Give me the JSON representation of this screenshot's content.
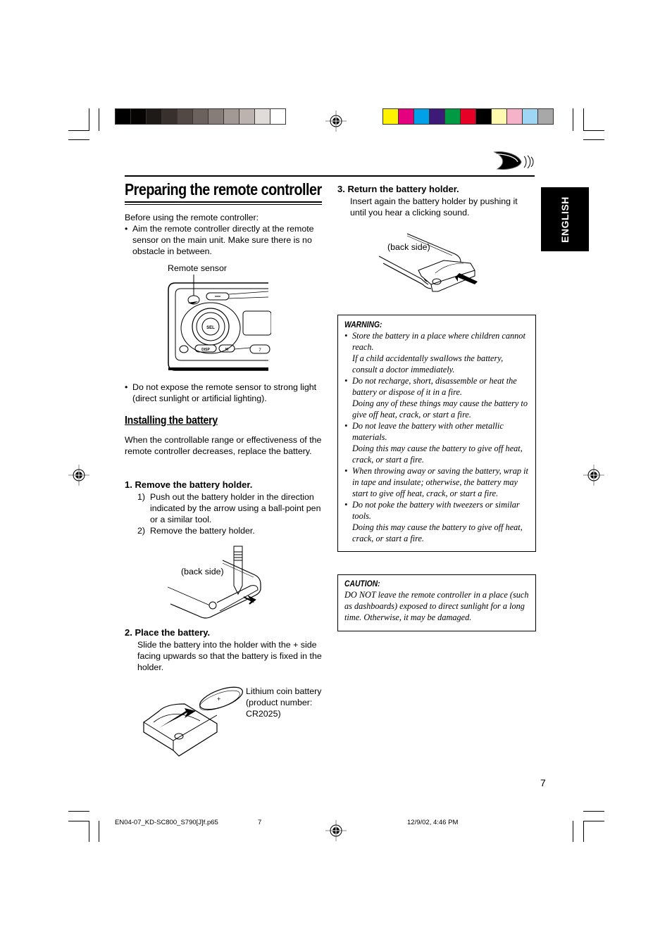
{
  "print_marks": {
    "grayscale_swatches": [
      "#000000",
      "#060403",
      "#1e1a17",
      "#38302c",
      "#524944",
      "#6b625e",
      "#877d78",
      "#a29894",
      "#bcb3af",
      "#e0dcd9",
      "#ffffff"
    ],
    "color_swatches": [
      "#fff200",
      "#e4007f",
      "#00a0e9",
      "#3e1a78",
      "#009944",
      "#e60026",
      "#000000",
      "#fff9b0",
      "#f5b2c9",
      "#9fd6f3",
      "#a8a8a8"
    ]
  },
  "header": {
    "language_tab": "ENGLISH",
    "logo_icon": "sound-wave-logo-icon"
  },
  "left_column": {
    "title": "Preparing the remote controller",
    "intro": "Before using the remote controller:",
    "bullets_1": [
      "Aim the remote controller directly at the remote sensor on the main unit. Make sure there is no obstacle in between."
    ],
    "figure_1": {
      "label": "Remote sensor",
      "button_labels": [
        "SEL",
        "DISP",
        "M",
        "7"
      ]
    },
    "bullets_2": [
      "Do not expose the remote sensor to strong light (direct sunlight or artificial lighting)."
    ],
    "subheading": "Installing the battery",
    "subheading_text": "When the controllable range or effectiveness of the remote controller decreases, replace the battery.",
    "step1": {
      "title": "1.  Remove the battery holder.",
      "items": [
        {
          "num": "1)",
          "text": "Push out the battery holder in the direction indicated by the arrow using a ball-point pen or a similar tool."
        },
        {
          "num": "2)",
          "text": "Remove the battery holder."
        }
      ],
      "figure_label": "(back side)"
    },
    "step2": {
      "title": "2.  Place the battery.",
      "text": "Slide the battery into the holder with the + side facing upwards so that the battery is fixed in the holder.",
      "figure_label": "Lithium coin battery (product number: CR2025)"
    }
  },
  "right_column": {
    "step3": {
      "title": "3.  Return the battery holder.",
      "text": "Insert again the battery holder by pushing it until you hear a clicking sound.",
      "figure_label": "(back side)"
    },
    "warning": {
      "heading": "WARNING:",
      "items": [
        {
          "main": "Store the battery in a place where children cannot reach.",
          "extra": "If a child accidentally swallows the battery, consult a doctor immediately."
        },
        {
          "main": "Do not recharge, short, disassemble or heat the battery or dispose of it in a fire.",
          "extra": "Doing any of these things may cause the battery to give off heat, crack, or start a fire."
        },
        {
          "main": "Do not leave the battery with other metallic materials.",
          "extra": "Doing this may cause the battery to give off heat, crack, or start a fire."
        },
        {
          "main": "When throwing away or saving the battery, wrap it in tape and insulate; otherwise, the battery may start to give off heat, crack, or start a fire.",
          "extra": ""
        },
        {
          "main": "Do not poke the battery with tweezers or similar tools.",
          "extra": "Doing this may cause the battery to give off heat, crack, or start a fire."
        }
      ]
    },
    "caution": {
      "heading": "CAUTION:",
      "text": "DO NOT leave the remote controller in a place (such as dashboards) exposed to direct sunlight for a long time. Otherwise, it may be damaged."
    }
  },
  "page_number": "7",
  "footer": {
    "filename": "EN04-07_KD-SC800_S790[J]f.p65",
    "page": "7",
    "timestamp": "12/9/02, 4:46 PM"
  }
}
